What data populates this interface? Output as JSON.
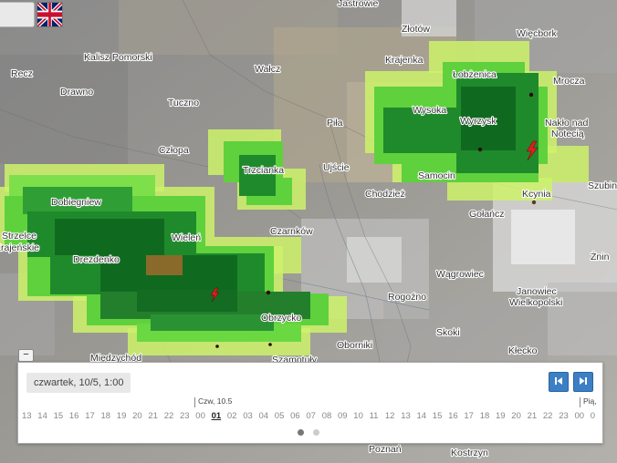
{
  "map": {
    "cities": [
      "Jastrowie",
      "Złotów",
      "Więcbork",
      "Kalisz Pomorski",
      "Recz",
      "Wałcz",
      "Krajenka",
      "Łobżenica",
      "Mrocza",
      "Drawno",
      "Tuczno",
      "Wysoka",
      "Wyrzysk",
      "Nakło nad",
      "Notecią",
      "Piła",
      "Człopa",
      "Trzcianka",
      "Ujście",
      "Samocin",
      "Szubin",
      "Dobiegniew",
      "Chodzież",
      "Kcynia",
      "Gołańcz",
      "Strzelce",
      "Krajeńskie",
      "Czarnków",
      "Wieleń",
      "Drezdenko",
      "Żnin",
      "Wągrowiec",
      "Rogoźno",
      "Janowiec",
      "Wielkopolski",
      "Obrzycko",
      "Skoki",
      "Oborniki",
      "Kłecko",
      "Międzychód",
      "Szamotuły",
      "Poznań",
      "Kostrzyn"
    ]
  },
  "controls": {
    "flag_icon": "uk-flag-icon",
    "collapse_label": "−"
  },
  "timeline": {
    "current": "czwartek, 10/5, 1:00",
    "day_start_label": "Czw, 10.5",
    "day_next_label": "Pią,",
    "prev_icon": "skip-prev-icon",
    "next_icon": "skip-next-icon",
    "hours": [
      "13",
      "14",
      "15",
      "16",
      "17",
      "18",
      "19",
      "20",
      "21",
      "22",
      "23",
      "00",
      "01",
      "02",
      "03",
      "04",
      "05",
      "06",
      "07",
      "08",
      "09",
      "10",
      "11",
      "12",
      "13",
      "14",
      "15",
      "16",
      "17",
      "18",
      "19",
      "20",
      "21",
      "22",
      "23",
      "00",
      "0"
    ],
    "active_hour_index": 12,
    "pages": 2,
    "active_page": 0
  },
  "colors": {
    "radar_light": "#ccf26a",
    "radar_mid": "#5fd13c",
    "radar_dark": "#1f8a2b",
    "radar_darkest": "#0f6a1f",
    "radar_core": "#8a6a2a",
    "lightning": "#d92020",
    "button": "#3d7fc4"
  }
}
